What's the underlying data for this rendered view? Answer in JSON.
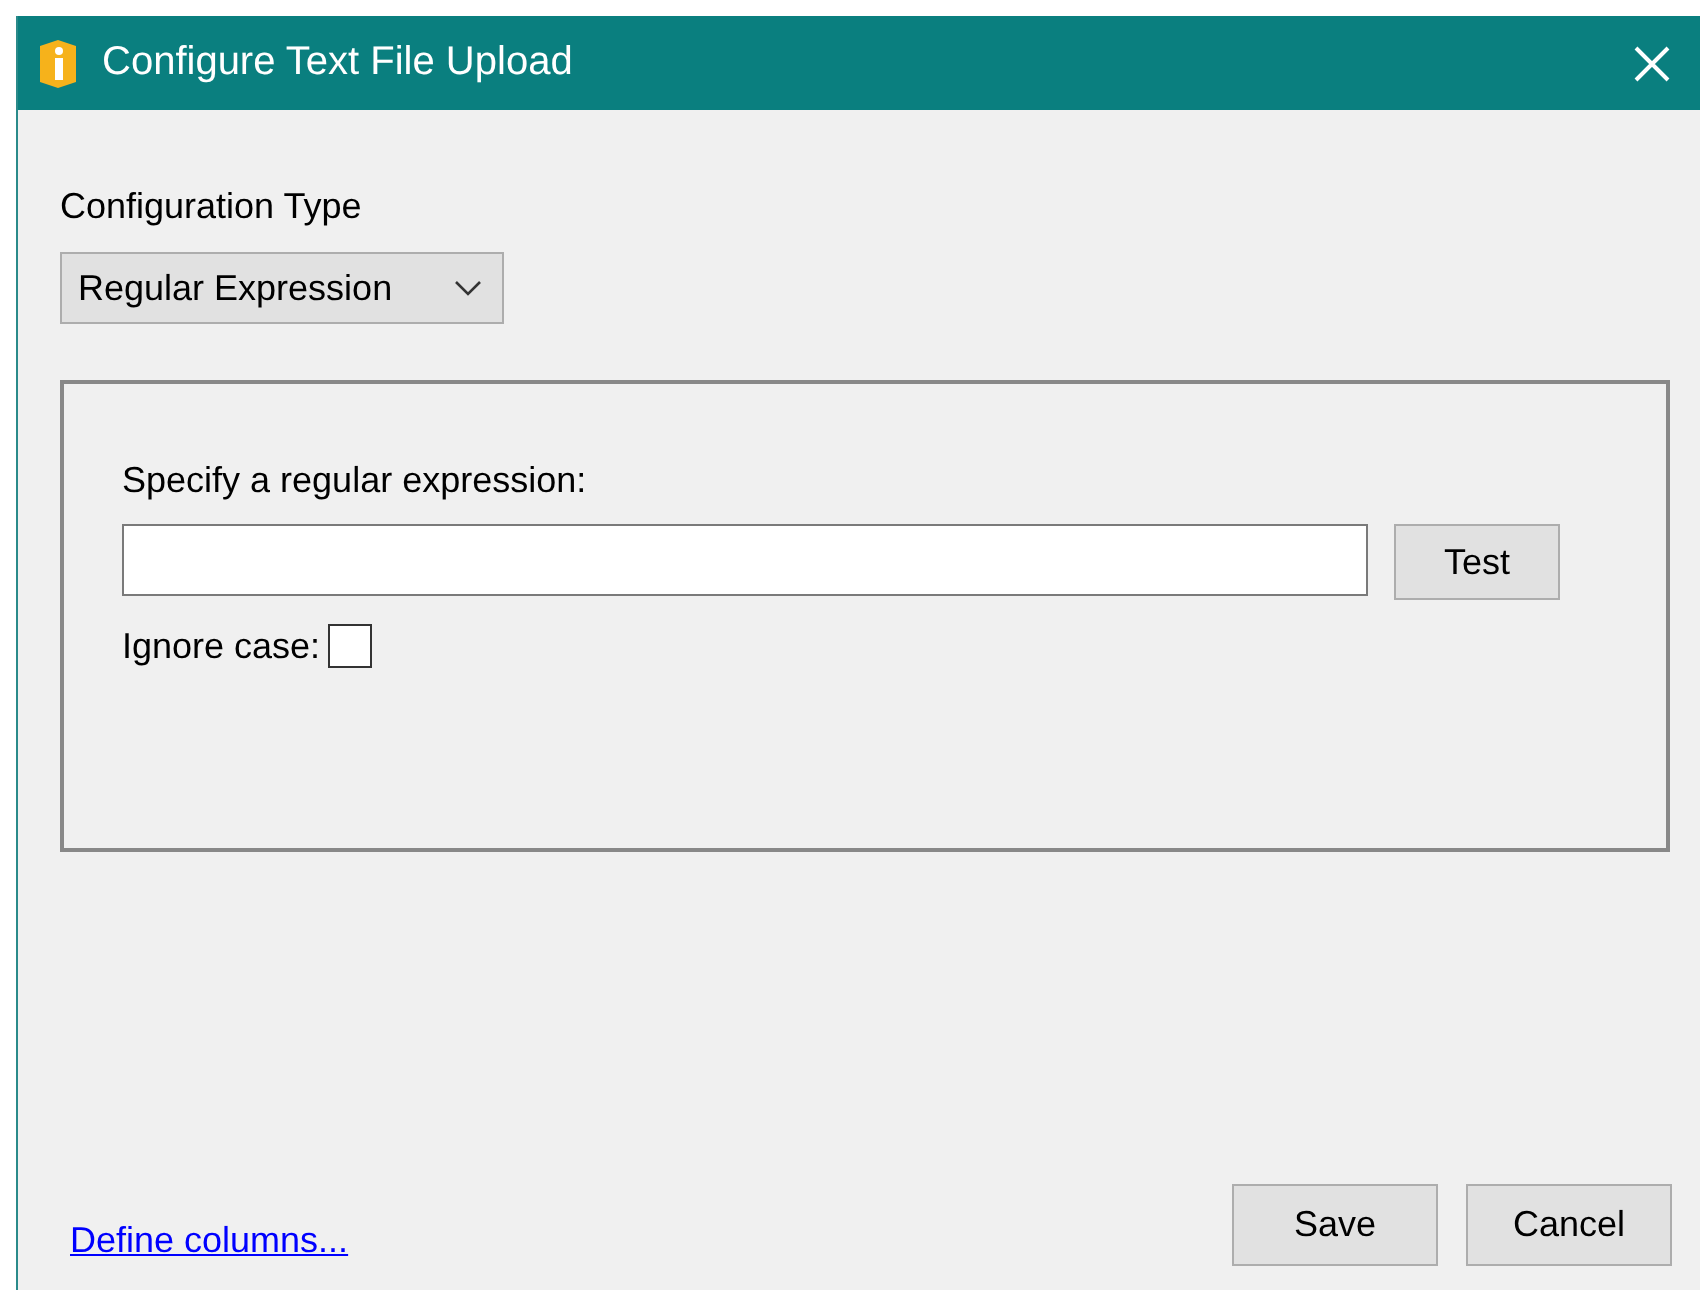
{
  "window": {
    "title": "Configure Text File Upload"
  },
  "configuration_type": {
    "label": "Configuration Type",
    "value": "Regular Expression"
  },
  "regex_group": {
    "label": "Specify a regular expression:",
    "test_button": "Test",
    "ignore_case": {
      "label": "Ignore case:",
      "checked": false
    }
  },
  "footer": {
    "link": "Define columns...",
    "buttons": [
      "Save",
      "Cancel"
    ]
  }
}
